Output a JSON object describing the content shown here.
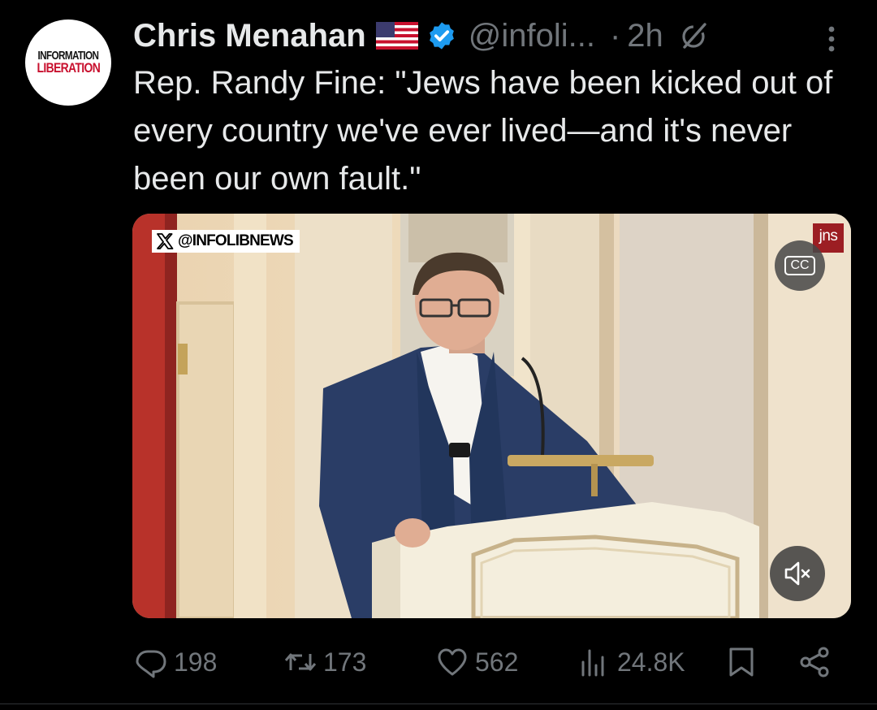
{
  "avatar": {
    "line1": "INFORMATION",
    "line2": "LIBERATION"
  },
  "tweet": {
    "author_name": "Chris Menahan",
    "flag_icon": "us-flag-icon",
    "handle": "@infoli...",
    "separator": "·",
    "time": "2h",
    "text": "Rep. Randy Fine: \"Jews have been kicked out of every country we've ever lived—and it's never been our own fault.\""
  },
  "media": {
    "watermark": "@INFOLIBNEWS",
    "channel_badge": "jns",
    "cc_label": "CC"
  },
  "actions": {
    "replies": "198",
    "reposts": "173",
    "likes": "562",
    "views": "24.8K"
  },
  "colors": {
    "background": "#000000",
    "text": "#e7e9ea",
    "secondary": "#71767b",
    "verified": "#1d9bf0",
    "jns": "#9c1e23"
  }
}
